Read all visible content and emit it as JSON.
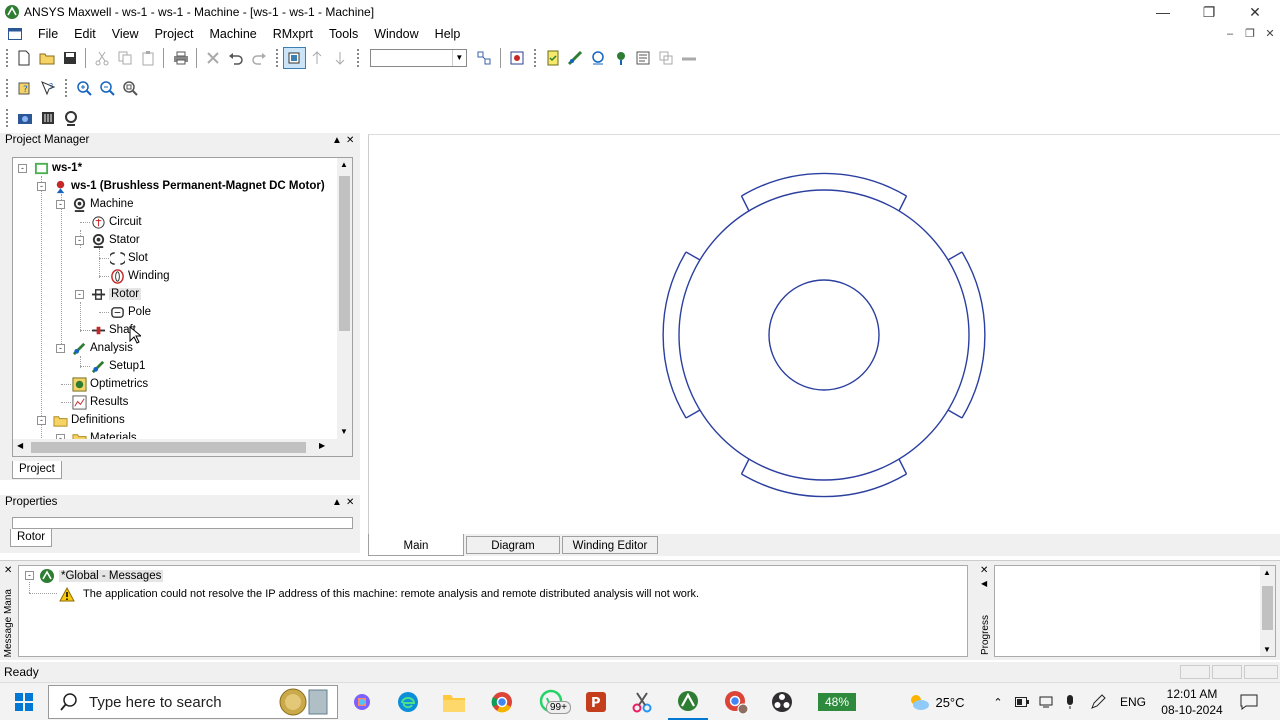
{
  "window": {
    "title": "ANSYS Maxwell - ws-1 - ws-1 - Machine - [ws-1 - ws-1 - Machine]"
  },
  "menu": [
    "File",
    "Edit",
    "View",
    "Project",
    "Machine",
    "RMxprt",
    "Tools",
    "Window",
    "Help"
  ],
  "project_manager": {
    "title": "Project Manager",
    "tab": "Project",
    "tree": [
      {
        "label": "ws-1*",
        "bold": true,
        "icon": "project-icon"
      },
      {
        "label": "ws-1 (Brushless Permanent-Magnet DC Motor)",
        "bold": true,
        "icon": "design-icon"
      },
      {
        "label": "Machine",
        "icon": "machine-icon"
      },
      {
        "label": "Circuit",
        "icon": "circuit-icon"
      },
      {
        "label": "Stator",
        "icon": "stator-icon"
      },
      {
        "label": "Slot",
        "icon": "slot-icon"
      },
      {
        "label": "Winding",
        "icon": "winding-icon"
      },
      {
        "label": "Rotor",
        "icon": "rotor-icon",
        "selected": true
      },
      {
        "label": "Pole",
        "icon": "pole-icon"
      },
      {
        "label": "Shaft",
        "icon": "shaft-icon"
      },
      {
        "label": "Analysis",
        "icon": "analysis-icon"
      },
      {
        "label": "Setup1",
        "icon": "setup-icon"
      },
      {
        "label": "Optimetrics",
        "icon": "optimetrics-icon"
      },
      {
        "label": "Results",
        "icon": "results-icon"
      },
      {
        "label": "Definitions",
        "icon": "folder-icon"
      },
      {
        "label": "Materials",
        "icon": "folder-icon"
      }
    ]
  },
  "properties": {
    "title": "Properties",
    "tab": "Rotor"
  },
  "view_tabs": [
    "Main",
    "Diagram",
    "Winding Editor"
  ],
  "messages": {
    "header": "*Global - Messages",
    "warning": "The application could not resolve the IP address of this machine: remote analysis and remote distributed analysis will not work.",
    "panel_label": "Message Mana",
    "progress_label": "Progress"
  },
  "status": "Ready",
  "taskbar": {
    "search_placeholder": "Type here to search",
    "whatsapp_badge": "99+",
    "battery": "48%",
    "temperature": "25°C",
    "language": "ENG",
    "time": "12:01 AM",
    "date": "08-10-2024"
  },
  "colors": {
    "drawing": "#2b3fa0",
    "panel_bg": "#f0f0f0",
    "selection": "#cce4f7"
  }
}
